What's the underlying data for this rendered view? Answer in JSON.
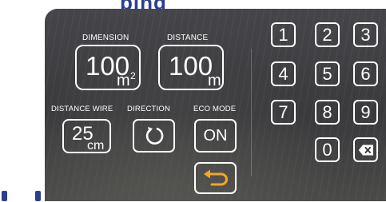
{
  "page": {
    "heading_fragment": "ping"
  },
  "settings": {
    "dimension": {
      "label": "DIMENSION",
      "value": "100",
      "unit": "m",
      "exponent": "2"
    },
    "distance": {
      "label": "DISTANCE",
      "value": "100",
      "unit": "m"
    },
    "distance_wire": {
      "label": "DISTANCE WIRE",
      "value": "25",
      "unit": "cm"
    },
    "direction": {
      "label": "DIRECTION",
      "icon": "rotate-icon"
    },
    "eco_mode": {
      "label": "ECO MODE",
      "value": "ON"
    },
    "back": {
      "icon": "return-arrow-icon",
      "accent_color": "#f5a623"
    }
  },
  "keypad": {
    "keys": [
      "1",
      "2",
      "3",
      "4",
      "5",
      "6",
      "7",
      "8",
      "9",
      "0"
    ],
    "delete_icon": "backspace-icon"
  },
  "colors": {
    "panel": "#3c3c3f",
    "text": "#ffffff",
    "accent": "#f5a623",
    "brand": "#2b3f8f"
  }
}
